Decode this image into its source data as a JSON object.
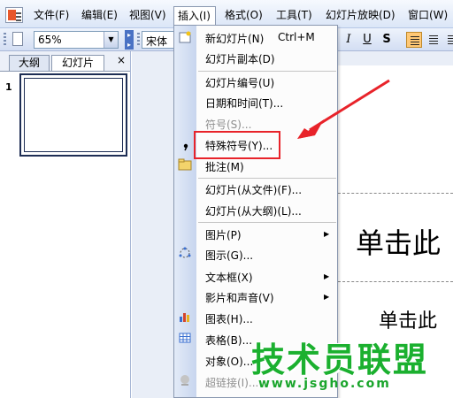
{
  "menubar": {
    "items": [
      "文件(F)",
      "编辑(E)",
      "视图(V)",
      "插入(I)",
      "格式(O)",
      "工具(T)",
      "幻灯片放映(D)",
      "窗口(W)"
    ]
  },
  "toolbar": {
    "zoom_value": "65%",
    "font_name": "宋体"
  },
  "left_pane": {
    "tabs": [
      "大纲",
      "幻灯片"
    ],
    "close_glyph": "×",
    "thumb_number": "1"
  },
  "insert_menu": {
    "items": [
      {
        "label": "新幻灯片(N)",
        "shortcut": "Ctrl+M"
      },
      {
        "label": "幻灯片副本(D)"
      },
      {
        "label": "幻灯片编号(U)"
      },
      {
        "label": "日期和时间(T)..."
      },
      {
        "label": "符号(S)...",
        "disabled": true
      },
      {
        "label": "特殊符号(Y)..."
      },
      {
        "label": "批注(M)"
      },
      {
        "label": "幻灯片(从文件)(F)..."
      },
      {
        "label": "幻灯片(从大纲)(L)..."
      },
      {
        "label": "图片(P)",
        "submenu": true
      },
      {
        "label": "图示(G)..."
      },
      {
        "label": "文本框(X)",
        "submenu": true
      },
      {
        "label": "影片和声音(V)",
        "submenu": true
      },
      {
        "label": "图表(H)..."
      },
      {
        "label": "表格(B)..."
      },
      {
        "label": "对象(O)..."
      },
      {
        "label": "超链接(I)...",
        "disabled": true
      }
    ]
  },
  "slide": {
    "title": "单击此",
    "subtitle": "单击此"
  },
  "watermark": {
    "logo": "技术员联盟",
    "url": "www.jsgho.com"
  },
  "colors": {
    "highlight": "#e8232a",
    "watermark": "#1bb02f"
  }
}
